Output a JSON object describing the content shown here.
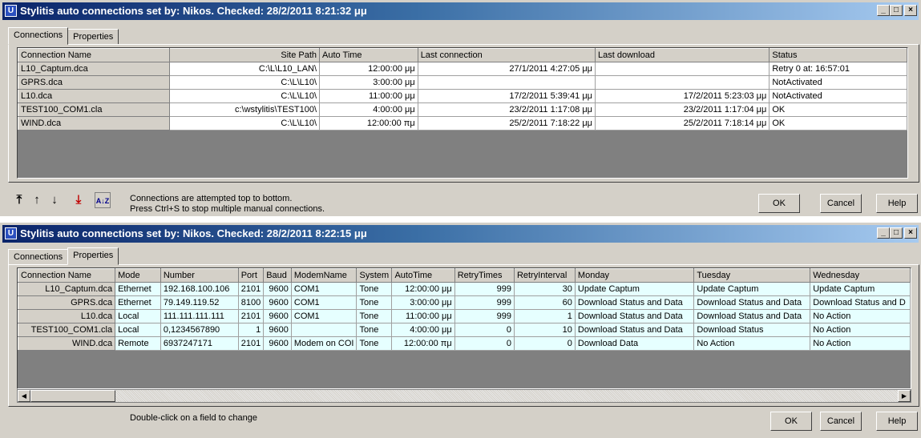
{
  "window1": {
    "title": "Stylitis auto connections set by: Nikos. Checked: 28/2/2011 8:21:32 μμ",
    "tabs": [
      "Connections",
      "Properties"
    ],
    "columns": [
      "Connection Name",
      "Site Path",
      "Auto Time",
      "Last connection",
      "Last download",
      "Status"
    ],
    "rows": [
      [
        "L10_Captum.dca",
        "C:\\L\\L10_LAN\\",
        "12:00:00 μμ",
        "27/1/2011 4:27:05 μμ",
        "",
        "Retry 0 at: 16:57:01"
      ],
      [
        "GPRS.dca",
        "C:\\L\\L10\\",
        "3:00:00 μμ",
        "",
        "",
        "NotActivated"
      ],
      [
        "L10.dca",
        "C:\\L\\L10\\",
        "11:00:00 μμ",
        "17/2/2011 5:39:41 μμ",
        "17/2/2011 5:23:03 μμ",
        "NotActivated"
      ],
      [
        "TEST100_COM1.cla",
        "c:\\wstylitis\\TEST100\\",
        "4:00:00 μμ",
        "23/2/2011 1:17:08 μμ",
        "23/2/2011 1:17:04 μμ",
        "OK"
      ],
      [
        "WIND.dca",
        "C:\\L\\L10\\",
        "12:00:00 πμ",
        "25/2/2011 7:18:22 μμ",
        "25/2/2011 7:18:14 μμ",
        "OK"
      ]
    ],
    "note_line1": "Connections are attempted top to bottom.",
    "note_line2": "Press Ctrl+S to stop multiple manual connections.",
    "ok": "OK",
    "cancel": "Cancel",
    "help": "Help"
  },
  "window2": {
    "title": "Stylitis auto connections set by: Nikos. Checked: 28/2/2011 8:22:15 μμ",
    "tabs": [
      "Connections",
      "Properties"
    ],
    "columns": [
      "Connection Name",
      "Mode",
      "Number",
      "Port",
      "Baud",
      "ModemName",
      "System",
      "AutoTime",
      "RetryTimes",
      "RetryInterval",
      "Monday",
      "Tuesday",
      "Wednesday"
    ],
    "rows": [
      [
        "L10_Captum.dca",
        "Ethernet",
        "192.168.100.106",
        "2101",
        "9600",
        "COM1",
        "Tone",
        "12:00:00 μμ",
        "999",
        "30",
        "Update Captum",
        "Update Captum",
        "Update Captum"
      ],
      [
        "GPRS.dca",
        "Ethernet",
        "79.149.119.52",
        "8100",
        "9600",
        "COM1",
        "Tone",
        "3:00:00 μμ",
        "999",
        "60",
        "Download Status and Data",
        "Download Status and Data",
        "Download Status and D"
      ],
      [
        "L10.dca",
        "Local",
        "111.111.111.111",
        "2101",
        "9600",
        "COM1",
        "Tone",
        "11:00:00 μμ",
        "999",
        "1",
        "Download Status and Data",
        "Download Status and Data",
        "No Action"
      ],
      [
        "TEST100_COM1.cla",
        "Local",
        "0,1234567890",
        "1",
        "9600",
        "",
        "Tone",
        "4:00:00 μμ",
        "0",
        "10",
        "Download Status and Data",
        "Download Status",
        "No Action"
      ],
      [
        "WIND.dca",
        "Remote",
        "6937247171",
        "2101",
        "9600",
        "Modem on COI",
        "Tone",
        "12:00:00 πμ",
        "0",
        "0",
        "Download Data",
        "No Action",
        "No Action"
      ]
    ],
    "note": "Double-click on a field to change",
    "ok": "OK",
    "cancel": "Cancel",
    "help": "Help"
  },
  "icons": {
    "move_top": "⤒",
    "move_up": "↑",
    "move_down": "↓",
    "move_bottom": "⤓",
    "sort": "A↓Z",
    "minimize": "_",
    "maximize": "□",
    "close": "×"
  }
}
